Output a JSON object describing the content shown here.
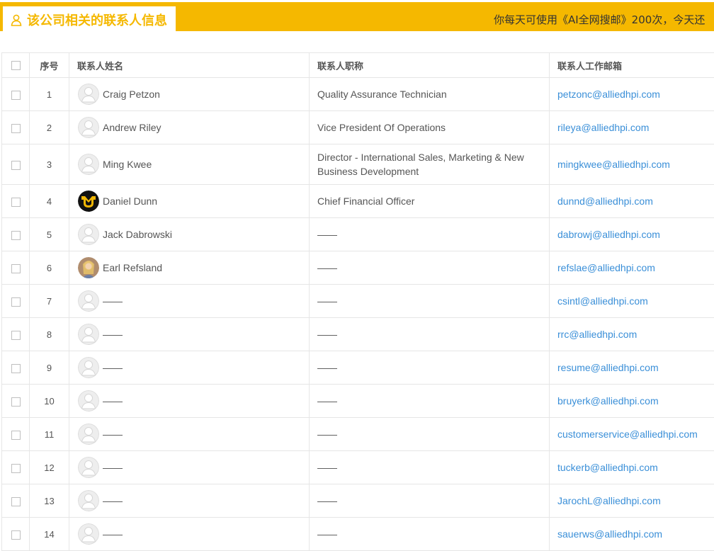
{
  "header": {
    "tab_title": "该公司相关的联系人信息",
    "notice": "你每天可使用《AI全网搜邮》200次，今天还"
  },
  "table": {
    "columns": {
      "number": "序号",
      "name": "联系人姓名",
      "title": "联系人职称",
      "email": "联系人工作邮箱"
    },
    "rows": [
      {
        "no": "1",
        "name": "Craig Petzon",
        "title": "Quality Assurance Technician",
        "email": "petzonc@alliedhpi.com",
        "avatar": "default-avatar"
      },
      {
        "no": "2",
        "name": "Andrew Riley",
        "title": "Vice President Of Operations",
        "email": "rileya@alliedhpi.com",
        "avatar": "default-avatar"
      },
      {
        "no": "3",
        "name": "Ming Kwee",
        "title": "Director - International Sales, Marketing & New Business Development",
        "email": "mingkwee@alliedhpi.com",
        "avatar": "default-avatar"
      },
      {
        "no": "4",
        "name": "Daniel Dunn",
        "title": "Chief Financial Officer",
        "email": "dunnd@alliedhpi.com",
        "avatar": "mizzou-logo-avatar"
      },
      {
        "no": "5",
        "name": "Jack Dabrowski",
        "title": "——",
        "email": "dabrowj@alliedhpi.com",
        "avatar": "default-avatar"
      },
      {
        "no": "6",
        "name": "Earl Refsland",
        "title": "——",
        "email": "refslae@alliedhpi.com",
        "avatar": "photo-avatar"
      },
      {
        "no": "7",
        "name": "——",
        "title": "——",
        "email": "csintl@alliedhpi.com",
        "avatar": "default-avatar"
      },
      {
        "no": "8",
        "name": "——",
        "title": "——",
        "email": "rrc@alliedhpi.com",
        "avatar": "default-avatar"
      },
      {
        "no": "9",
        "name": "——",
        "title": "——",
        "email": "resume@alliedhpi.com",
        "avatar": "default-avatar"
      },
      {
        "no": "10",
        "name": "——",
        "title": "——",
        "email": "bruyerk@alliedhpi.com",
        "avatar": "default-avatar"
      },
      {
        "no": "11",
        "name": "——",
        "title": "——",
        "email": "customerservice@alliedhpi.com",
        "avatar": "default-avatar"
      },
      {
        "no": "12",
        "name": "——",
        "title": "——",
        "email": "tuckerb@alliedhpi.com",
        "avatar": "default-avatar"
      },
      {
        "no": "13",
        "name": "——",
        "title": "——",
        "email": "JarochL@alliedhpi.com",
        "avatar": "default-avatar"
      },
      {
        "no": "14",
        "name": "——",
        "title": "——",
        "email": "sauerws@alliedhpi.com",
        "avatar": "default-avatar"
      }
    ]
  },
  "colors": {
    "accent": "#f5b800",
    "link": "#3a8fd8",
    "border": "#e6e6e6"
  }
}
